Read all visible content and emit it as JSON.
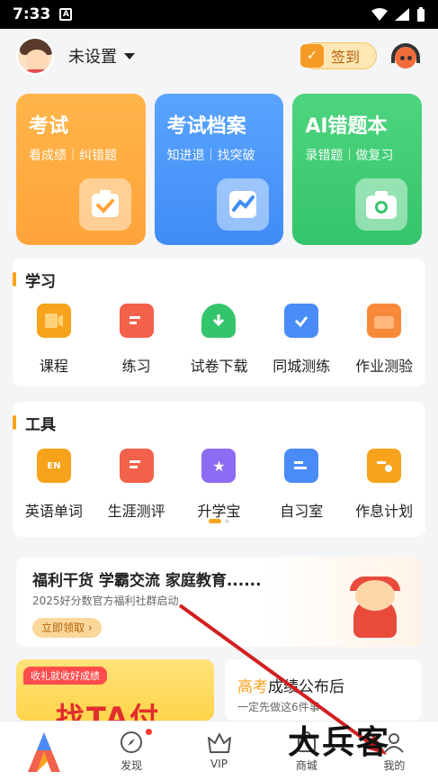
{
  "status_bar": {
    "time": "7:33"
  },
  "header": {
    "username": "未设置",
    "signin_label": "签到"
  },
  "feature_cards": [
    {
      "title": "考试",
      "subtitle": "看成绩｜纠错题",
      "color": "#ffa43a",
      "icon": "check-icon"
    },
    {
      "title": "考试档案",
      "subtitle": "知进退｜找突破",
      "color": "#3f8cf5",
      "icon": "trend-chart-icon"
    },
    {
      "title": "AI错题本",
      "subtitle": "录错题｜做复习",
      "color": "#34c46b",
      "icon": "camera-icon"
    }
  ],
  "study": {
    "title": "学习",
    "items": [
      {
        "label": "课程",
        "icon": "course-icon",
        "color": "#f7a31c"
      },
      {
        "label": "练习",
        "icon": "practice-icon",
        "color": "#f2614a"
      },
      {
        "label": "试卷下载",
        "icon": "download-icon",
        "color": "#34c46b"
      },
      {
        "label": "同城测练",
        "icon": "city-test-icon",
        "color": "#4a8cf7"
      },
      {
        "label": "作业测验",
        "icon": "homework-icon",
        "color": "#f78a3a"
      }
    ]
  },
  "tools": {
    "title": "工具",
    "items": [
      {
        "label": "英语单词",
        "icon": "english-words-icon",
        "color": "#f7a31c",
        "glyph": "EN"
      },
      {
        "label": "生涯测评",
        "icon": "career-test-icon",
        "color": "#f2614a",
        "glyph": ""
      },
      {
        "label": "升学宝",
        "icon": "star-book-icon",
        "color": "#8b6cf2",
        "glyph": "★"
      },
      {
        "label": "自习室",
        "icon": "study-room-icon",
        "color": "#4a8cf7",
        "glyph": ""
      },
      {
        "label": "作息计划",
        "icon": "schedule-icon",
        "color": "#f7a31c",
        "glyph": ""
      }
    ]
  },
  "banner": {
    "headline": "福利干货 学霸交流 家庭教育......",
    "subline": "2025好分数官方福利社群启动",
    "button": "立即领取 ›"
  },
  "promo_left": {
    "tag": "收礼就收好成绩",
    "big_text": "找TA付"
  },
  "promo_right": {
    "highlight": "高考",
    "headline_rest": "成绩公布后",
    "subline": "一定先做这6件事"
  },
  "tabbar": [
    {
      "label": "",
      "icon": "app-logo-icon"
    },
    {
      "label": "发现",
      "icon": "compass-icon",
      "badge": true
    },
    {
      "label": "VIP",
      "icon": "crown-icon"
    },
    {
      "label": "商城",
      "icon": "shop-icon"
    },
    {
      "label": "我的",
      "icon": "profile-icon"
    }
  ],
  "watermark": "大兵客"
}
